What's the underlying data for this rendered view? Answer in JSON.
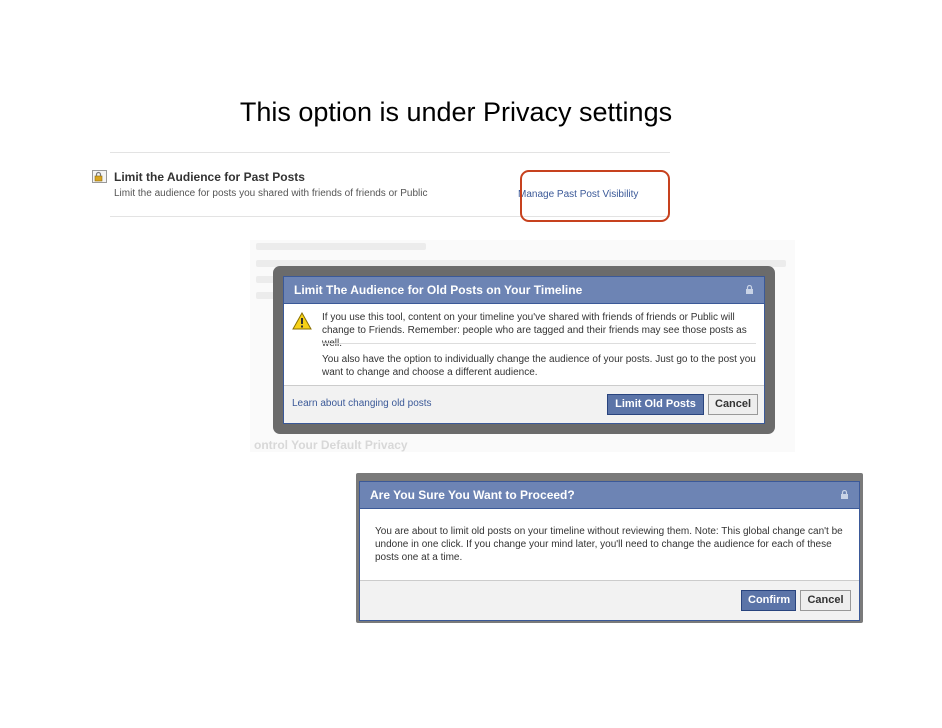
{
  "slide": {
    "title": "This option is under Privacy settings"
  },
  "settings_row": {
    "title": "Limit the Audience for Past Posts",
    "subtitle": "Limit the audience for posts you shared with friends of friends or Public",
    "link": "Manage Past Post Visibility",
    "icon": "lock-icon"
  },
  "background_page": {
    "heading_bottom": "ontrol Your Default Privacy"
  },
  "dialog_limit": {
    "title": "Limit The Audience for Old Posts on Your Timeline",
    "warning_line1": "If you use this tool, content on your timeline you've shared with friends of friends or Public will",
    "warning_line2": "change to Friends. Remember: people who are tagged and their friends may see those posts as well.",
    "info_line1": "You also have the option to individually change the audience of your posts. Just go to the post you",
    "info_line2": "want to change and choose a different audience.",
    "footer_link": "Learn about changing old posts",
    "primary_button": "Limit Old Posts",
    "cancel_button": "Cancel",
    "icons": [
      "lock-icon",
      "warning-icon"
    ]
  },
  "dialog_confirm": {
    "title": "Are You Sure You Want to Proceed?",
    "body_line1": "You are about to limit old posts on your timeline without reviewing them. Note: This global change can't be",
    "body_line2": "undone in one click. If you change your mind later, you'll need to change the audience for each of these",
    "body_line3": "posts one at a time.",
    "primary_button": "Confirm",
    "cancel_button": "Cancel"
  },
  "colors": {
    "header_blue": "#6d84b4",
    "border_blue": "#3b5998",
    "button_blue": "#5b74a8",
    "highlight_red": "#c7411e"
  }
}
